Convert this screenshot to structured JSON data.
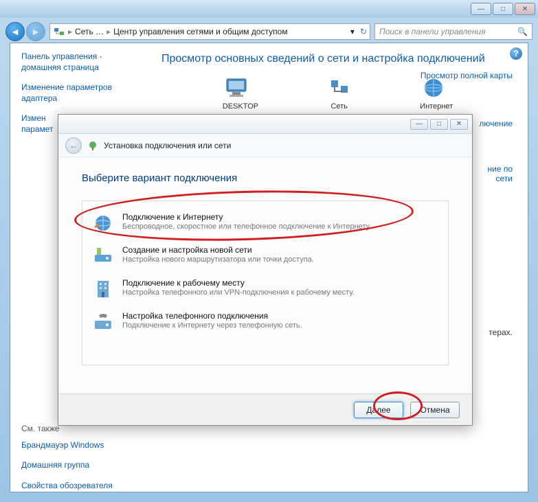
{
  "titlebar": {
    "minimize": "—",
    "maximize": "□",
    "close": "✕"
  },
  "nav": {
    "breadcrumb_root": "Сеть …",
    "breadcrumb_current": "Центр управления сетями и общим доступом",
    "search_placeholder": "Поиск в панели управления"
  },
  "sidebar": {
    "home": "Панель управления - домашняя страница",
    "adapter": "Изменение параметров адаптера",
    "sharing": "Измен\nпарамет",
    "see_also": "См. также",
    "firewall": "Брандмауэр Windows",
    "homegroup": "Домашняя группа",
    "ie_options": "Свойства обозревателя"
  },
  "main": {
    "title": "Просмотр основных сведений о сети и настройка подключений",
    "map_link": "Просмотр полной карты",
    "partial1": "лючение",
    "partial2": "ние по\nсети",
    "partial3": "терах.",
    "node_desktop": "DESKTOP",
    "node_network": "Сеть",
    "node_internet": "Интернет"
  },
  "wizard": {
    "header_title": "Установка подключения или сети",
    "heading": "Выберите вариант подключения",
    "options": [
      {
        "title": "Подключение к Интернету",
        "desc": "Беспроводное, скоростное или телефонное подключение к Интернету."
      },
      {
        "title": "Создание и настройка новой сети",
        "desc": "Настройка нового маршрутизатора или точки доступа."
      },
      {
        "title": "Подключение к рабочему месту",
        "desc": "Настройка телефонного или VPN-подключения к рабочему месту."
      },
      {
        "title": "Настройка телефонного подключения",
        "desc": "Подключение к Интернету через телефонную сеть."
      }
    ],
    "next": "Далее",
    "cancel": "Отмена",
    "min": "—",
    "max": "□",
    "close": "✕"
  }
}
